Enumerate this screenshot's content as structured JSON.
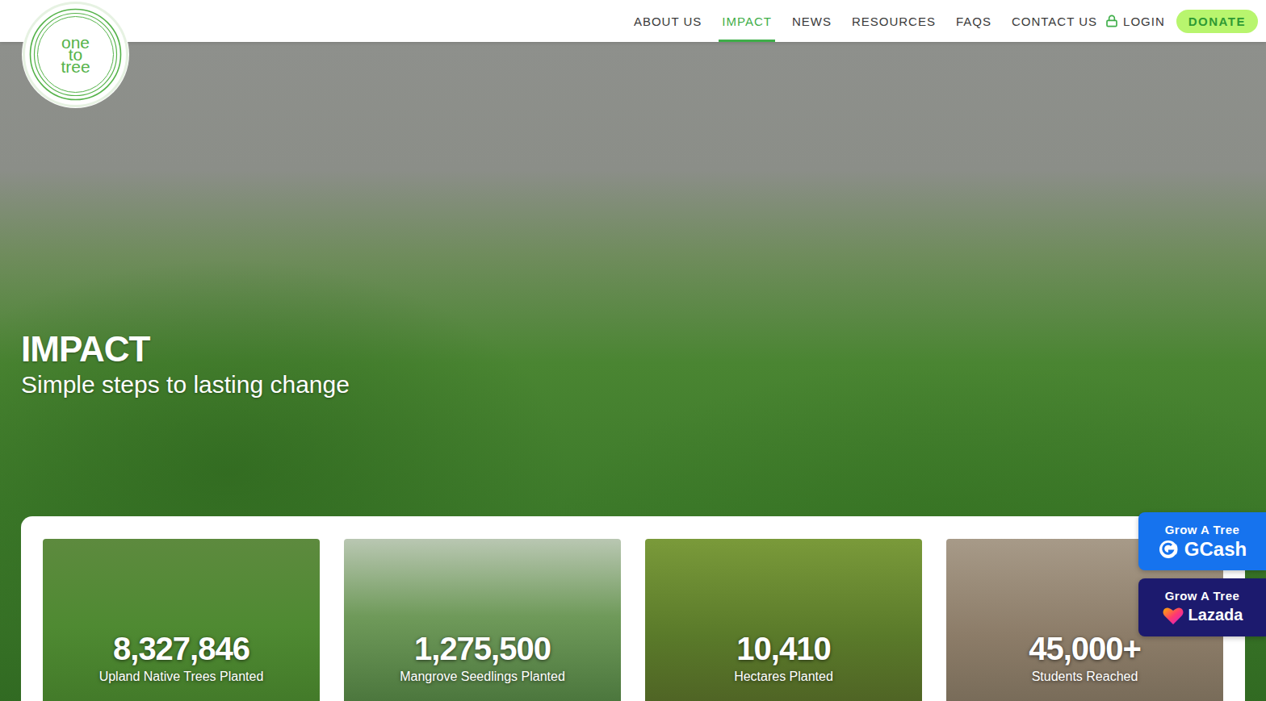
{
  "logo": {
    "lines": [
      "one",
      "to",
      "tree"
    ]
  },
  "nav": [
    {
      "label": "ABOUT US",
      "selected": false
    },
    {
      "label": "IMPACT",
      "selected": true
    },
    {
      "label": "NEWS",
      "selected": false
    },
    {
      "label": "RESOURCES",
      "selected": false
    },
    {
      "label": "FAQS",
      "selected": false
    },
    {
      "label": "CONTACT US",
      "selected": false
    }
  ],
  "login": {
    "label": "LOGIN"
  },
  "donate": {
    "label": "DONATE"
  },
  "hero": {
    "title": "IMPACT",
    "subtitle": "Simple steps to lasting change"
  },
  "stats": [
    {
      "value": "8,327,846",
      "label": "Upland Native Trees Planted"
    },
    {
      "value": "1,275,500",
      "label": "Mangrove Seedlings Planted"
    },
    {
      "value": "10,410",
      "label": "Hectares Planted"
    },
    {
      "value": "45,000+",
      "label": "Students Reached"
    }
  ],
  "floating_buttons": [
    {
      "title": "Grow A Tree",
      "brand": "GCash",
      "color": "#1673ee"
    },
    {
      "title": "Grow A Tree",
      "brand": "Lazada",
      "color": "#1c1a6e"
    }
  ]
}
